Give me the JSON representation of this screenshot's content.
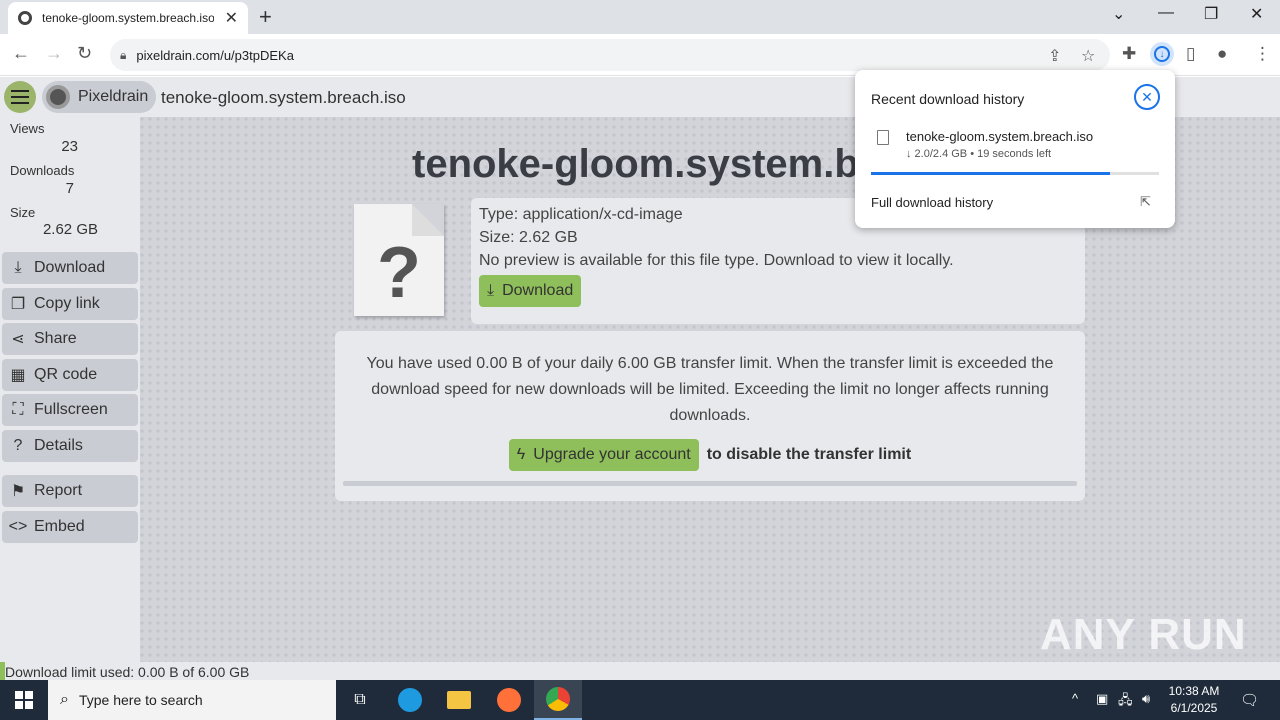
{
  "browser": {
    "tab_title": "tenoke-gloom.system.breach.iso",
    "url": "pixeldrain.com/u/p3tpDEKa"
  },
  "site": {
    "brand": "Pixeldrain",
    "file_name": "tenoke-gloom.system.breach.iso"
  },
  "sidebar": {
    "stats": [
      {
        "label": "Views",
        "value": "23"
      },
      {
        "label": "Downloads",
        "value": "7"
      },
      {
        "label": "Size",
        "value": "2.62 GB"
      }
    ],
    "buttons": [
      {
        "label": "Download",
        "icon": "download-icon"
      },
      {
        "label": "Copy link",
        "icon": "copy-icon"
      },
      {
        "label": "Share",
        "icon": "share-icon"
      },
      {
        "label": "QR code",
        "icon": "qr-code-icon"
      },
      {
        "label": "Fullscreen",
        "icon": "fullscreen-icon"
      },
      {
        "label": "Details",
        "icon": "help-icon"
      },
      {
        "label": "Report",
        "icon": "flag-icon"
      },
      {
        "label": "Embed",
        "icon": "code-icon"
      }
    ]
  },
  "viewer": {
    "title": "tenoke-gloom.system.br",
    "type_line": "Type: application/x-cd-image",
    "size_line": "Size: 2.62 GB",
    "preview_line": "No preview is available for this file type. Download to view it locally.",
    "download_label": "Download",
    "limit_text": "You have used 0.00 B of your daily 6.00 GB transfer limit. When the transfer limit is exceeded the download speed for new downloads will be limited. Exceeding the limit no longer affects running downloads.",
    "upgrade_label": "Upgrade your account",
    "upgrade_tail": "to disable the transfer limit",
    "usage_fraction": 0.0
  },
  "status_line": "Download limit used: 0.00 B of 6.00 GB",
  "download_popup": {
    "heading": "Recent download history",
    "file": "tenoke-gloom.system.breach.iso",
    "status": "↓ 2.0/2.4 GB • 19 seconds left",
    "progress": 0.83,
    "full_history": "Full download history"
  },
  "watermark": "ANY RUN",
  "taskbar": {
    "search_placeholder": "Type here to search",
    "time": "10:38 AM",
    "date": "6/1/2025"
  },
  "colors": {
    "accent_green": "#8fbf5a",
    "chrome_blue": "#1a73e8",
    "page_bg": "#e8e9ed"
  }
}
